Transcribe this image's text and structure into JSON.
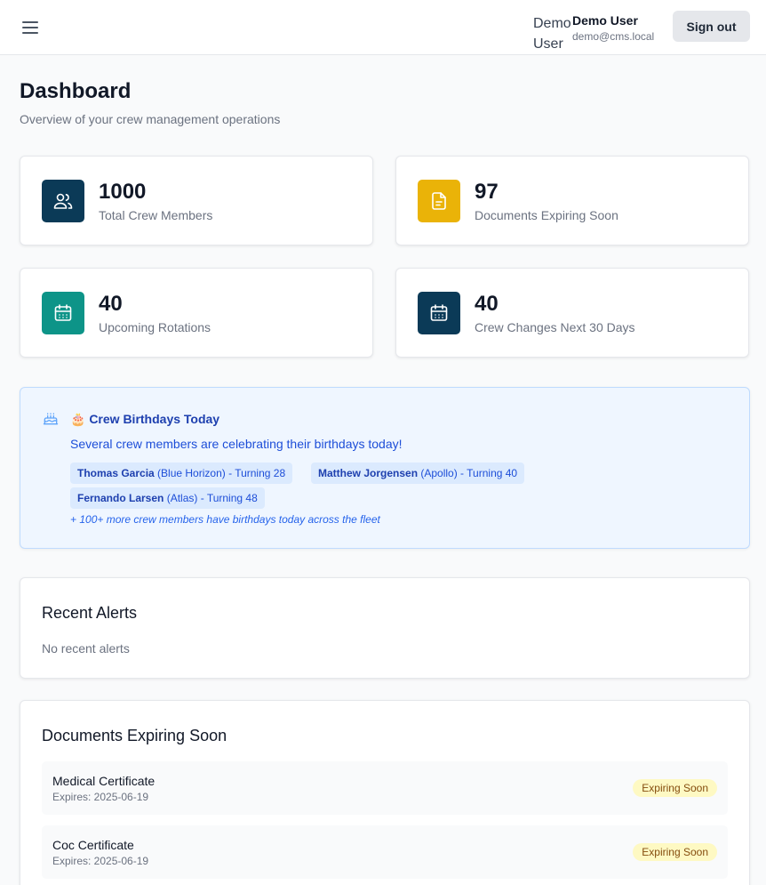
{
  "header": {
    "user_first": "Demo User",
    "user_name": "Demo User",
    "user_email": "demo@cms.local",
    "signout_label": "Sign out"
  },
  "page": {
    "title": "Dashboard",
    "subtitle": "Overview of your crew management operations"
  },
  "stats": [
    {
      "value": "1000",
      "label": "Total Crew Members",
      "icon": "users-icon",
      "color": "#0b3a57"
    },
    {
      "value": "97",
      "label": "Documents Expiring Soon",
      "icon": "document-icon",
      "color": "#eab308"
    },
    {
      "value": "40",
      "label": "Upcoming Rotations",
      "icon": "calendar-icon",
      "color": "#0d9488"
    },
    {
      "value": "40",
      "label": "Crew Changes Next 30 Days",
      "icon": "calendar-icon",
      "color": "#0b3a57"
    }
  ],
  "birthdays": {
    "title": "🎂 Crew Birthdays Today",
    "message": "Several crew members are celebrating their birthdays today!",
    "people": [
      {
        "name": "Thomas Garcia",
        "detail": "(Blue Horizon) - Turning 28"
      },
      {
        "name": "Matthew Jorgensen",
        "detail": "(Apollo) - Turning 40"
      },
      {
        "name": "Fernando Larsen",
        "detail": "(Atlas) - Turning 48"
      }
    ],
    "more": "+ 100+ more crew members have birthdays today across the fleet"
  },
  "alerts": {
    "title": "Recent Alerts",
    "empty": "No recent alerts"
  },
  "documents": {
    "title": "Documents Expiring Soon",
    "items": [
      {
        "name": "Medical Certificate",
        "expires": "Expires: 2025-06-19",
        "status": "Expiring Soon"
      },
      {
        "name": "Coc Certificate",
        "expires": "Expires: 2025-06-19",
        "status": "Expiring Soon"
      }
    ]
  }
}
